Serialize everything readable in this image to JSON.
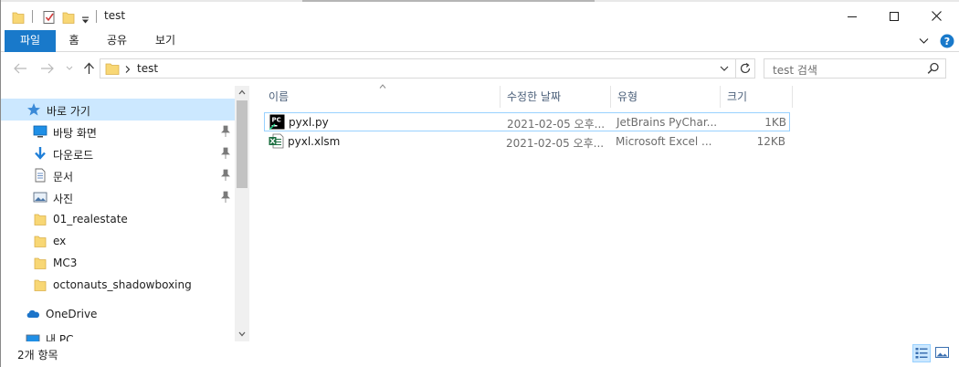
{
  "window": {
    "title": "test"
  },
  "ribbon": {
    "tabs": [
      "파일",
      "홈",
      "공유",
      "보기"
    ]
  },
  "address": {
    "path_segment": "test"
  },
  "search": {
    "placeholder": "test 검색"
  },
  "nav": {
    "quick_access": "바로 가기",
    "pinned": [
      "바탕 화면",
      "다운로드",
      "문서",
      "사진"
    ],
    "folders": [
      "01_realestate",
      "ex",
      "MC3",
      "octonauts_shadowboxing"
    ],
    "onedrive": "OneDrive",
    "this_pc": "내 PC"
  },
  "columns": {
    "name": "이름",
    "date": "수정한 날짜",
    "type": "유형",
    "size": "크기"
  },
  "files": [
    {
      "name": "pyxl.py",
      "date": "2021-02-05 오후...",
      "type": "JetBrains PyChar...",
      "size": "1KB",
      "icon": "pycharm-file-icon"
    },
    {
      "name": "pyxl.xlsm",
      "date": "2021-02-05 오후...",
      "type": "Microsoft Excel ...",
      "size": "12KB",
      "icon": "excel-file-icon"
    }
  ],
  "status": {
    "item_count": "2개 항목"
  },
  "colors": {
    "accent": "#1979ca",
    "selection": "#cce8ff",
    "folder": "#f8d775"
  }
}
